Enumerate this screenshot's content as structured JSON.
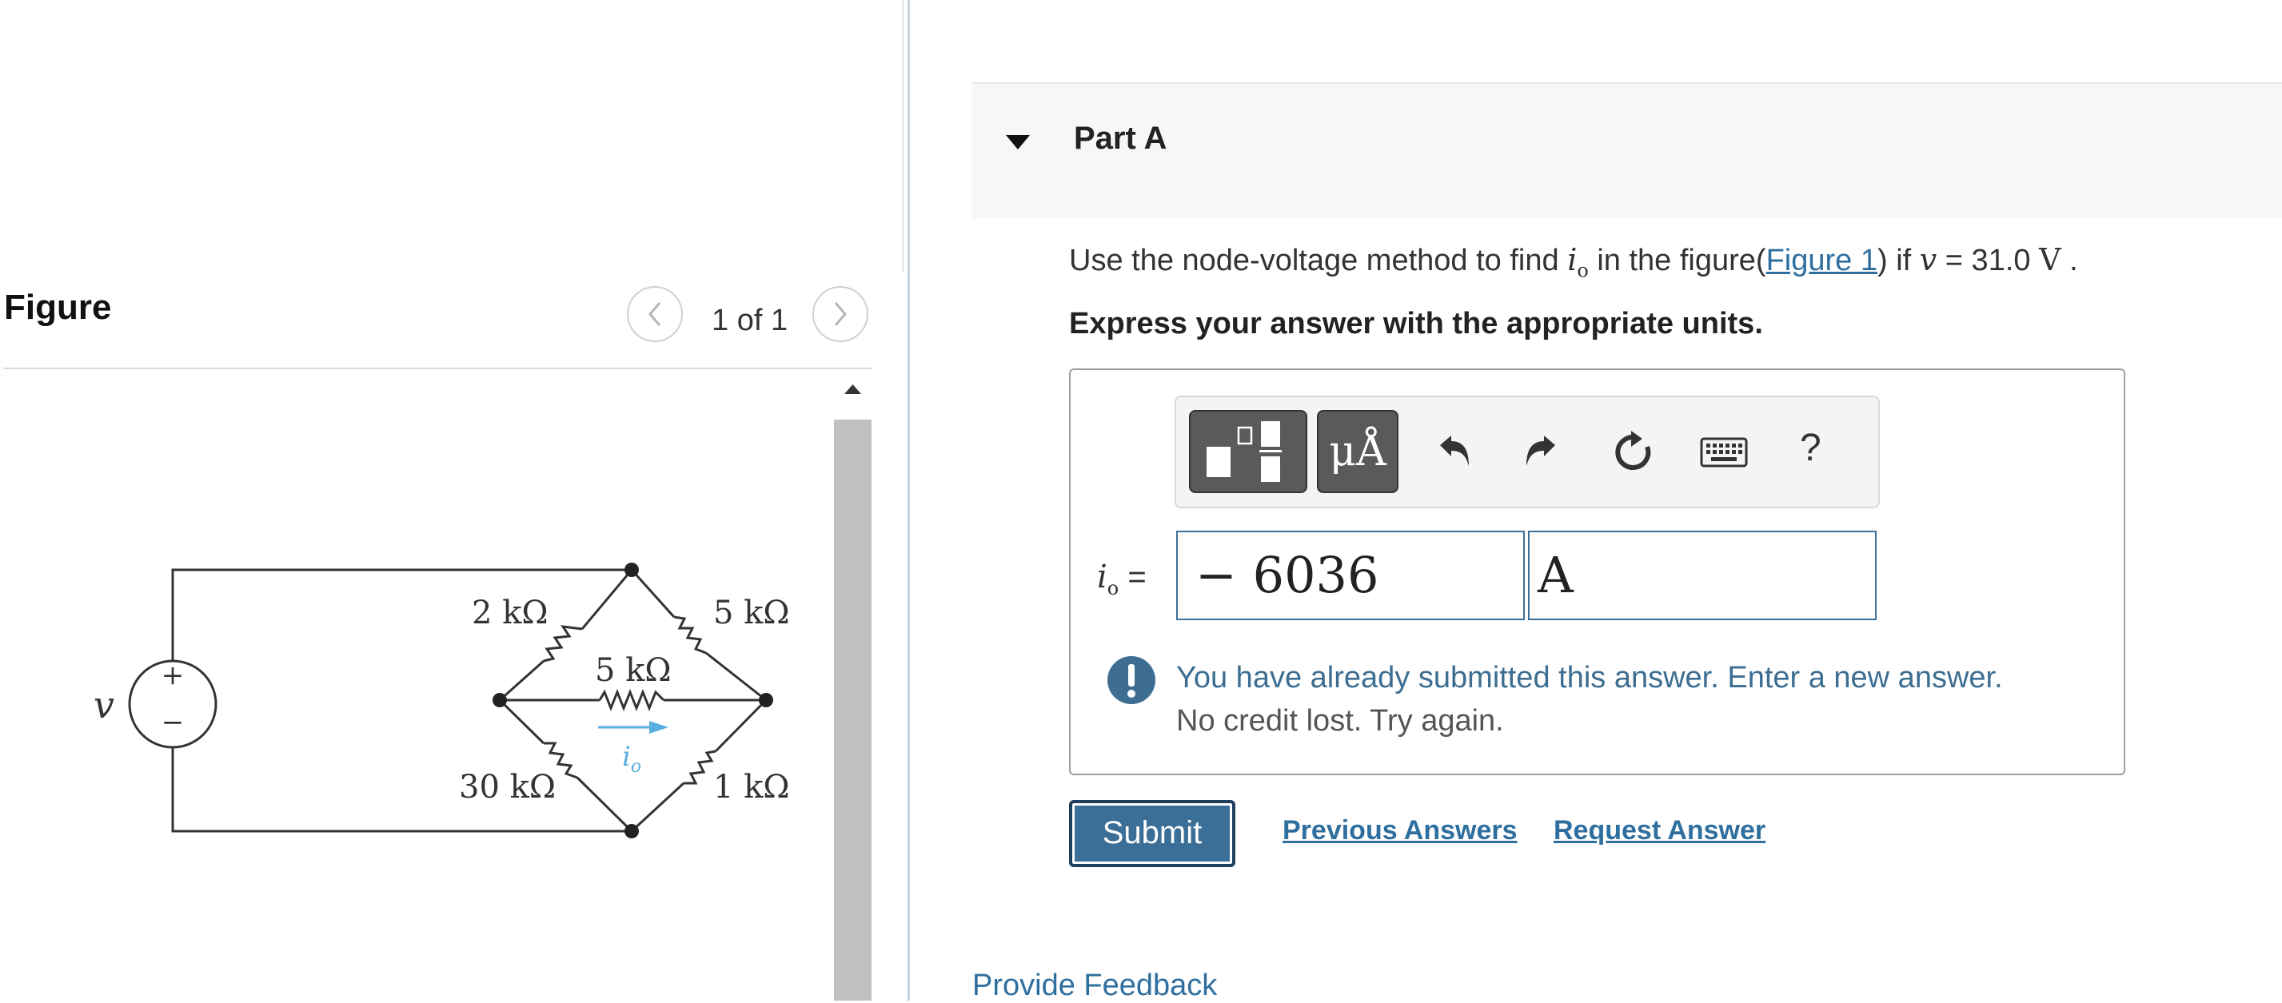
{
  "figure_panel": {
    "title": "Figure",
    "page_indicator": "1 of 1",
    "circuit": {
      "source_label": "v",
      "plus": "+",
      "minus": "−",
      "r1": "2 kΩ",
      "r2": "5 kΩ",
      "r3": "5 kΩ",
      "r4": "30 kΩ",
      "r5": "1 kΩ",
      "current": "i",
      "current_sub": "o"
    }
  },
  "part": {
    "title": "Part A",
    "question": {
      "before": "Use the node-voltage method to find ",
      "var": "i",
      "var_sub": "o",
      "middle": " in the figure(",
      "link": "Figure 1",
      "after_link": ") if ",
      "v_var": "v",
      "equals": " = 31.0 ",
      "unit": "V",
      "end": " ."
    },
    "instructions": "Express your answer with the appropriate units."
  },
  "toolbar": {
    "units_label": "μÅ",
    "help_label": "?"
  },
  "answer": {
    "var": "i",
    "var_sub": "o",
    "equals": " =",
    "value": "− 6036",
    "unit": "A"
  },
  "alert": {
    "message": "You have already submitted this answer. Enter a new answer.",
    "sub": "No credit lost. Try again."
  },
  "actions": {
    "submit": "Submit",
    "previous_answers": "Previous Answers",
    "request_answer": "Request Answer"
  },
  "footer": {
    "feedback": "Provide Feedback"
  },
  "colors": {
    "accent": "#3b6f97",
    "link": "#2f6f9f",
    "current_arrow": "#5aaee0"
  }
}
